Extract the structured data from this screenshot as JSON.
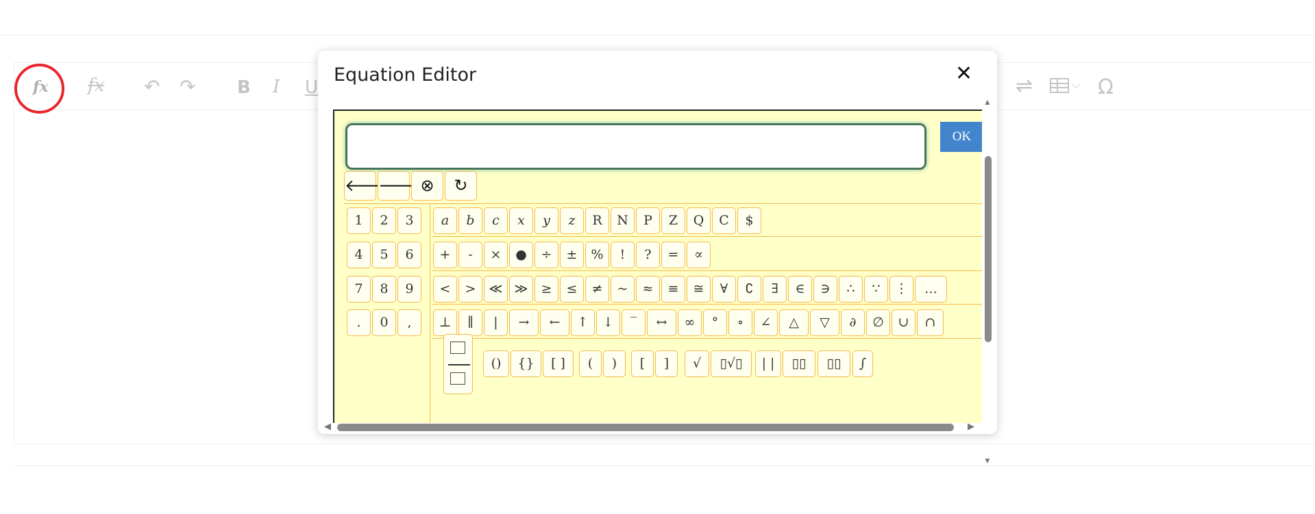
{
  "toolbar": {
    "fx": "fx",
    "fx_off": "fx",
    "undo": "↶",
    "redo": "↷",
    "bold": "B",
    "italic": "I",
    "underline": "U",
    "swap": "⇌",
    "table_caret": "⌵",
    "omega": "Ω"
  },
  "modal": {
    "title": "Equation Editor",
    "close": "✕",
    "input_value": "",
    "ok": "OK",
    "controls": [
      "🡐",
      "🡒",
      "⊗",
      "↻"
    ],
    "digits": [
      [
        "1",
        "2",
        "3"
      ],
      [
        "4",
        "5",
        "6"
      ],
      [
        "7",
        "8",
        "9"
      ],
      [
        ".",
        "0",
        ","
      ]
    ],
    "symbols_row1": [
      "a",
      "b",
      "c",
      "x",
      "y",
      "z",
      "R",
      "N",
      "P",
      "Z",
      "Q",
      "C",
      "$"
    ],
    "symbols_row2": [
      "+",
      "-",
      "×",
      "●",
      "÷",
      "±",
      "%",
      "!",
      "?",
      "=",
      "∝"
    ],
    "symbols_row3": [
      "<",
      ">",
      "≪",
      "≫",
      "≥",
      "≤",
      "≠",
      "~",
      "≈",
      "≡",
      "≅",
      "∀",
      "∁",
      "∃",
      "∈",
      "∋",
      "∴",
      "∵",
      "⋮",
      "…"
    ],
    "symbols_row4": [
      "⊥",
      "∥",
      "|",
      "→",
      "←",
      "↑",
      "↓",
      "‾",
      "↔",
      "∞",
      "°",
      "∘",
      "∠",
      "△",
      "▽",
      "∂",
      "∅",
      "∪",
      "∩"
    ],
    "symbols_row5": [
      "()",
      "{}",
      "[ ]",
      "(",
      ")",
      "[",
      "]",
      "√",
      "▯√▯",
      "| |",
      "▯▯",
      "▯▯",
      "∫"
    ]
  }
}
